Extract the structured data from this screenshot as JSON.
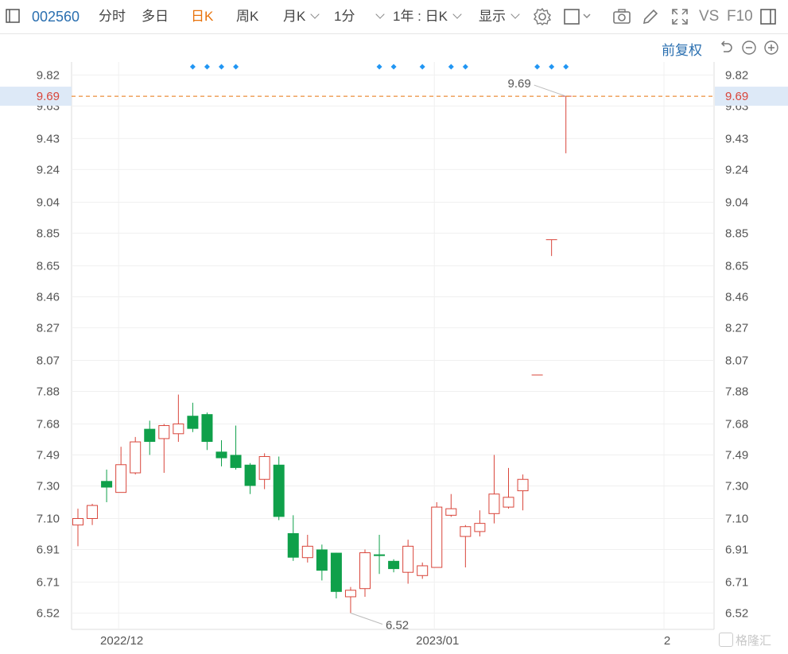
{
  "toolbar": {
    "stock_code": "002560",
    "tabs": [
      {
        "label": "分时",
        "active": false
      },
      {
        "label": "多日",
        "active": false
      },
      {
        "label": "日K",
        "active": true
      },
      {
        "label": "周K",
        "active": false
      },
      {
        "label": "月K",
        "active": false
      }
    ],
    "interval": "1分",
    "range": "1年 : 日K",
    "display": "显示",
    "vs": "VS",
    "f10": "F10",
    "adjust": "前复权"
  },
  "colors": {
    "up": "#d9453a",
    "down": "#0fa04a",
    "accent": "#e8730c",
    "link": "#2a6fb0",
    "marker": "#2196f3"
  },
  "watermark": "格隆汇",
  "chart_data": {
    "type": "candlestick",
    "ylim": [
      6.42,
      9.9
    ],
    "y_ticks": [
      9.82,
      9.63,
      9.43,
      9.24,
      9.04,
      8.85,
      8.65,
      8.46,
      8.27,
      8.07,
      7.88,
      7.68,
      7.49,
      7.3,
      7.1,
      6.91,
      6.71,
      6.52
    ],
    "y_tick_labels": [
      "9.82",
      "9.63",
      "9.43",
      "9.24",
      "9.04",
      "8.85",
      "8.65",
      "8.46",
      "8.27",
      "8.07",
      "7.88",
      "7.68",
      "7.49",
      "7.30",
      "7.10",
      "6.91",
      "6.71",
      "6.52"
    ],
    "x_labels": [
      {
        "label": "2022/12",
        "index": 3
      },
      {
        "label": "2023/01",
        "index": 25
      },
      {
        "label": "2",
        "index": 41
      }
    ],
    "current_price": 9.69,
    "current_price_label": "9.69",
    "max_label": "9.69",
    "min_label": "6.52",
    "max_index": 34,
    "min_index": 19,
    "event_markers": [
      8,
      9,
      10,
      11,
      21,
      22,
      24,
      26,
      27,
      32,
      33,
      34
    ],
    "candles": [
      {
        "o": 7.06,
        "h": 7.16,
        "l": 6.93,
        "c": 7.1
      },
      {
        "o": 7.1,
        "h": 7.19,
        "l": 7.06,
        "c": 7.18
      },
      {
        "o": 7.33,
        "h": 7.4,
        "l": 7.2,
        "c": 7.29
      },
      {
        "o": 7.26,
        "h": 7.54,
        "l": 7.26,
        "c": 7.43
      },
      {
        "o": 7.38,
        "h": 7.6,
        "l": 7.37,
        "c": 7.57
      },
      {
        "o": 7.65,
        "h": 7.7,
        "l": 7.49,
        "c": 7.57
      },
      {
        "o": 7.59,
        "h": 7.68,
        "l": 7.38,
        "c": 7.67
      },
      {
        "o": 7.62,
        "h": 7.86,
        "l": 7.57,
        "c": 7.68
      },
      {
        "o": 7.73,
        "h": 7.81,
        "l": 7.63,
        "c": 7.65
      },
      {
        "o": 7.74,
        "h": 7.75,
        "l": 7.52,
        "c": 7.57
      },
      {
        "o": 7.51,
        "h": 7.58,
        "l": 7.42,
        "c": 7.47
      },
      {
        "o": 7.49,
        "h": 7.67,
        "l": 7.4,
        "c": 7.41
      },
      {
        "o": 7.43,
        "h": 7.44,
        "l": 7.25,
        "c": 7.3
      },
      {
        "o": 7.34,
        "h": 7.5,
        "l": 7.28,
        "c": 7.48
      },
      {
        "o": 7.43,
        "h": 7.48,
        "l": 7.09,
        "c": 7.11
      },
      {
        "o": 7.01,
        "h": 7.12,
        "l": 6.84,
        "c": 6.86
      },
      {
        "o": 6.86,
        "h": 7.0,
        "l": 6.83,
        "c": 6.93
      },
      {
        "o": 6.91,
        "h": 6.94,
        "l": 6.72,
        "c": 6.78
      },
      {
        "o": 6.89,
        "h": 6.89,
        "l": 6.61,
        "c": 6.65
      },
      {
        "o": 6.62,
        "h": 6.68,
        "l": 6.52,
        "c": 6.66
      },
      {
        "o": 6.67,
        "h": 6.91,
        "l": 6.62,
        "c": 6.89
      },
      {
        "o": 6.88,
        "h": 7.0,
        "l": 6.76,
        "c": 6.87
      },
      {
        "o": 6.84,
        "h": 6.85,
        "l": 6.77,
        "c": 6.79
      },
      {
        "o": 6.77,
        "h": 6.97,
        "l": 6.7,
        "c": 6.93
      },
      {
        "o": 6.75,
        "h": 6.83,
        "l": 6.73,
        "c": 6.81
      },
      {
        "o": 6.8,
        "h": 7.2,
        "l": 6.8,
        "c": 7.17
      },
      {
        "o": 7.12,
        "h": 7.25,
        "l": 7.11,
        "c": 7.16
      },
      {
        "o": 6.99,
        "h": 7.06,
        "l": 6.8,
        "c": 7.05
      },
      {
        "o": 7.02,
        "h": 7.15,
        "l": 6.99,
        "c": 7.07
      },
      {
        "o": 7.13,
        "h": 7.49,
        "l": 7.07,
        "c": 7.25
      },
      {
        "o": 7.17,
        "h": 7.41,
        "l": 7.16,
        "c": 7.23
      },
      {
        "o": 7.27,
        "h": 7.37,
        "l": 7.15,
        "c": 7.34
      },
      {
        "o": 7.98,
        "h": 7.98,
        "l": 7.98,
        "c": 7.98
      },
      {
        "o": 8.81,
        "h": 8.81,
        "l": 8.71,
        "c": 8.81
      },
      {
        "o": 9.69,
        "h": 9.69,
        "l": 9.34,
        "c": 9.69
      }
    ]
  }
}
